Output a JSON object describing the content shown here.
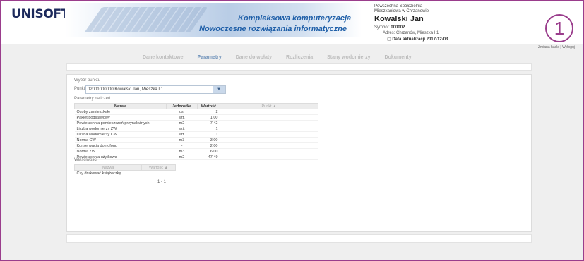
{
  "header": {
    "logo": "UNISOFT",
    "tagline1": "Kompleksowa komputeryzacja",
    "tagline2": "Nowoczesne rozwiązania informatyczne",
    "company_line1": "Powszechna Spółdzielnia",
    "company_line2": "Mieszkaniowa w Chrzanowie",
    "user_name": "Kowalski Jan",
    "symbol_label": "Symbol:",
    "symbol_value": "000002",
    "address_label": "Adres:",
    "address_value": "Chrzanów, Mieszka I 1",
    "update_label": "Data aktualizacji 2017-12-03",
    "badge": "1",
    "link_change_password": "Zmiana hasła",
    "link_separator": "|",
    "link_logout": "Wyloguj"
  },
  "nav": {
    "tabs": [
      {
        "label": "Dane kontaktowe"
      },
      {
        "label": "Parametry"
      },
      {
        "label": "Dane do wpłaty"
      },
      {
        "label": "Rozliczenia"
      },
      {
        "label": "Stany wodomierzy"
      },
      {
        "label": "Dokumenty"
      }
    ],
    "active_color": "#6b8fb8"
  },
  "content": {
    "section_select_title": "Wybór punktu",
    "points_label": "Punkty:",
    "points_value": "02001000000,Kowalski Jan, Mieszka I 1",
    "section_params_title": "Parametry naliczeń",
    "params_headers": [
      "Nazwa",
      "Jednostka",
      "Wartość",
      "Punkt ▲"
    ],
    "params_rows": [
      [
        "Osoby zamieszkałe",
        "os.",
        "2",
        ""
      ],
      [
        "Pakiet podstawowy",
        "szt.",
        "1,00",
        ""
      ],
      [
        "Powierzchnia pomieszczeń przynależnych",
        "m2",
        "7,42",
        ""
      ],
      [
        "Liczba wodomierzy ZW",
        "szt.",
        "1",
        ""
      ],
      [
        "Liczba wodomierzy CW",
        "szt.",
        "1",
        ""
      ],
      [
        "Norma CW",
        "m3",
        "3,00",
        ""
      ],
      [
        "Konserwacja domofonu",
        "-",
        "2,00",
        ""
      ],
      [
        "Norma ZW",
        "m3",
        "6,00",
        ""
      ],
      [
        "Powierzchnia użytkowa",
        "m2",
        "47,49",
        ""
      ]
    ],
    "section_props_title": "Właściwości",
    "props_headers": [
      "Nazwa",
      "Wartość ▲"
    ],
    "props_rows": [
      [
        "Czy drukować książeczkę",
        ""
      ]
    ],
    "pager": "1 - 1"
  },
  "colors": {
    "frame": "#9a3d8c",
    "brand": "#1f5fa8"
  }
}
